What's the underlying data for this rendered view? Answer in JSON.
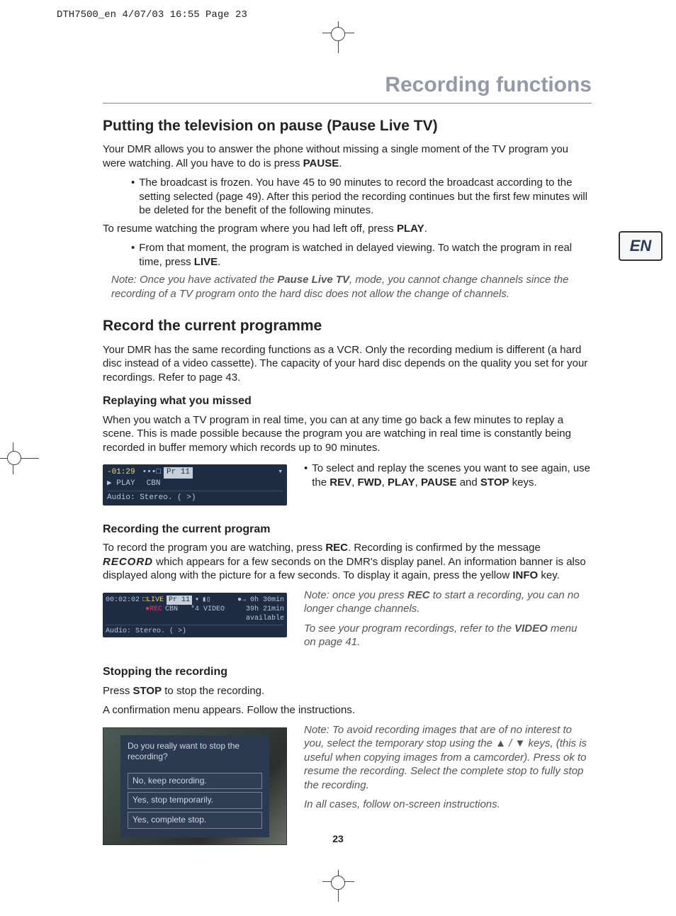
{
  "header_line": "DTH7500_en  4/07/03  16:55  Page 23",
  "lang_tab": "EN",
  "page_number": "23",
  "section_title": "Recording functions",
  "h2_pause": "Putting the television on pause (Pause Live TV)",
  "pause_intro_1": "Your DMR allows you to answer the phone without missing a single moment of the TV program you were watching. All you have to do is press ",
  "PAUSE": "PAUSE",
  "pause_bullet1": "The broadcast is frozen. You have 45 to 90 minutes to record the broadcast according to the setting selected (page 49). After this period the recording continues but the first few minutes will be deleted for the benefit of the following minutes.",
  "resume_line_pre": "To resume watching the program where you had left off, press ",
  "PLAY": "PLAY",
  "resume_bullet_pre": "From that moment, the program is watched in delayed viewing. To watch the program in real time, press ",
  "LIVE": "LIVE",
  "note_pause_pre": "Note: Once you have activated the ",
  "note_pause_bold": "Pause Live TV",
  "note_pause_post": ", mode, you cannot change channels since the recording of a TV program onto the hard disc does not allow the change of channels.",
  "h2_record": "Record the current programme",
  "record_intro": "Your DMR has the same recording functions as a VCR. Only the recording medium is different (a hard disc instead of a video cassette). The capacity of your hard disc depends on the quality you set for your recordings. Refer to page 43.",
  "h3_replay": "Replaying what you missed",
  "replay_p": "When you watch a TV program in real time, you can at any time go back a few minutes to replay a scene. This is made possible because the program you are watching in real time is constantly being recorded in buffer memory which records up to 90 minutes.",
  "osd1": {
    "time": "-01:29",
    "signal": "•••□",
    "pr": "Pr 11",
    "cbn": "CBN",
    "play_label": "▶ PLAY",
    "audio": "Audio: Stereo. ( >)"
  },
  "replay_bullet_pre": "To select and replay the scenes you want to see again, use the ",
  "keys_list": {
    "REV": "REV",
    "FWD": "FWD",
    "PLAY2": "PLAY",
    "PAUSE2": "PAUSE",
    "STOP": "STOP"
  },
  "h3_recprog": "Recording the current program",
  "recprog_p_pre": "To record the program you are watching, press ",
  "REC": "REC",
  "recprog_p_mid1": ". Recording is confirmed by the message ",
  "record_glyph": "RECORD",
  "recprog_p_mid2": " which appears for a few seconds on the DMR's display panel. An information banner is also displayed along with the picture for a few seconds. To display it again, press the yellow ",
  "INFO": "INFO",
  "key_word": " key.",
  "osd2": {
    "time": "00:02:02",
    "live": "□LIVE",
    "rec": "●REC",
    "pr": "Pr 11",
    "cbn": "CBN",
    "mode": "*4 VIDEO",
    "remaining1": "●→  0h 30min",
    "remaining2": "39h 21min",
    "available": "available",
    "audio": "Audio: Stereo. ( >)"
  },
  "note_rec_pre": "Note: once you press ",
  "note_rec_post": " to start a recording, you can no longer change channels.",
  "note_video_pre": "To see your program recordings, refer to the ",
  "VIDEO": "VIDEO",
  "note_video_post": " menu on page 41.",
  "h3_stop": "Stopping the recording",
  "stop_p1_pre": "Press ",
  "STOP2": "STOP",
  "stop_p1_post": " to stop the recording.",
  "stop_p2": "A confirmation menu appears. Follow the instructions.",
  "dialog": {
    "question": "Do you really want to stop the recording?",
    "opt1": "No, keep recording.",
    "opt2": "Yes, stop temporarily.",
    "opt3": "Yes, complete stop."
  },
  "note_stop_1_pre": "Note: To avoid recording images that are of no interest to you, select the temporary stop using the ",
  "arrows": "▲ / ▼",
  "note_stop_1_post": " keys, (this is useful when copying images from a camcorder). Press ok to resume the recording. Select the complete stop to fully stop the recording.",
  "note_stop_2": "In all cases, follow on-screen instructions."
}
